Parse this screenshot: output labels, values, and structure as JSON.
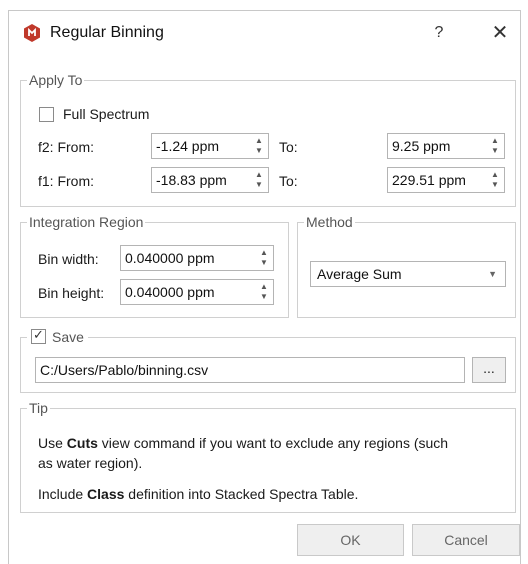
{
  "window": {
    "title": "Regular Binning",
    "help_label": "?",
    "close_label": "✕",
    "logo_icon": "mnova-logo-icon",
    "accent_color": "#c0392b"
  },
  "apply_to": {
    "legend": "Apply To",
    "full_spectrum_label": "Full Spectrum",
    "full_spectrum_checked": false,
    "f2_from_label": "f2: From:",
    "f2_from_value": "-1.24 ppm",
    "f2_to_label": "To:",
    "f2_to_value": "9.25 ppm",
    "f1_from_label": "f1: From:",
    "f1_from_value": "-18.83 ppm",
    "f1_to_label": "To:",
    "f1_to_value": "229.51 ppm"
  },
  "integration_region": {
    "legend": "Integration Region",
    "bin_width_label": "Bin width:",
    "bin_width_value": "0.040000 ppm",
    "bin_height_label": "Bin height:",
    "bin_height_value": "0.040000 ppm"
  },
  "method": {
    "legend": "Method",
    "selected": "Average Sum"
  },
  "save": {
    "legend": "Save",
    "checked": true,
    "path": "C:/Users/Pablo/binning.csv",
    "browse_label": "..."
  },
  "tip": {
    "legend": "Tip",
    "line1_prefix": "Use ",
    "line1_bold": "Cuts",
    "line1_rest": " view command if you want to exclude any regions (such",
    "line2": "as water region).",
    "line3_prefix": "Include ",
    "line3_bold": "Class",
    "line3_rest": " definition into Stacked Spectra Table."
  },
  "buttons": {
    "ok_label": "OK",
    "cancel_label": "Cancel"
  }
}
